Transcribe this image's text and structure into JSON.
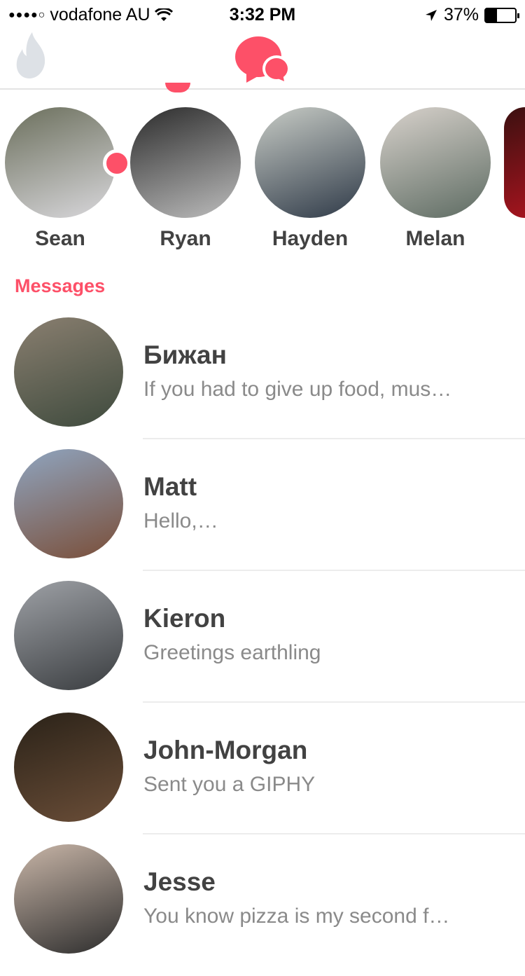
{
  "status_bar": {
    "signal": "●●●●○",
    "carrier": "vodafone AU",
    "time": "3:32 PM",
    "battery": "37%",
    "battery_level": 0.37
  },
  "colors": {
    "accent": "#fd5068",
    "flame": "#dde1e6"
  },
  "section_title": "Messages",
  "matches": [
    {
      "name": "Sean",
      "unread": true,
      "colors": [
        "#6b6f5c",
        "#d9d8dc"
      ]
    },
    {
      "name": "Ryan",
      "unread": false,
      "colors": [
        "#2b2b2b",
        "#bdbdbd"
      ]
    },
    {
      "name": "Hayden",
      "unread": false,
      "colors": [
        "#c8ccc6",
        "#2f3a48"
      ]
    },
    {
      "name": "Melan",
      "unread": false,
      "colors": [
        "#d8d2cc",
        "#5d6b62"
      ]
    },
    {
      "name": "",
      "unread": false,
      "colors": [
        "#3b1010",
        "#a3141e"
      ]
    }
  ],
  "conversations": [
    {
      "name": "Бижан",
      "message": "If you had to give up food, mus…",
      "colors": [
        "#8a7f70",
        "#3e4a3d"
      ]
    },
    {
      "name": "Matt",
      "message": "Hello,…",
      "colors": [
        "#8fa5c0",
        "#7a4e38"
      ]
    },
    {
      "name": "Kieron",
      "message": "Greetings earthling",
      "colors": [
        "#9ea1a6",
        "#3a3d40"
      ]
    },
    {
      "name": "John-Morgan",
      "message": "Sent you a GIPHY",
      "colors": [
        "#2a2218",
        "#6b4e38"
      ]
    },
    {
      "name": "Jesse",
      "message": "You know pizza is my second f…",
      "colors": [
        "#c9b6a8",
        "#2d2d2d"
      ]
    }
  ]
}
